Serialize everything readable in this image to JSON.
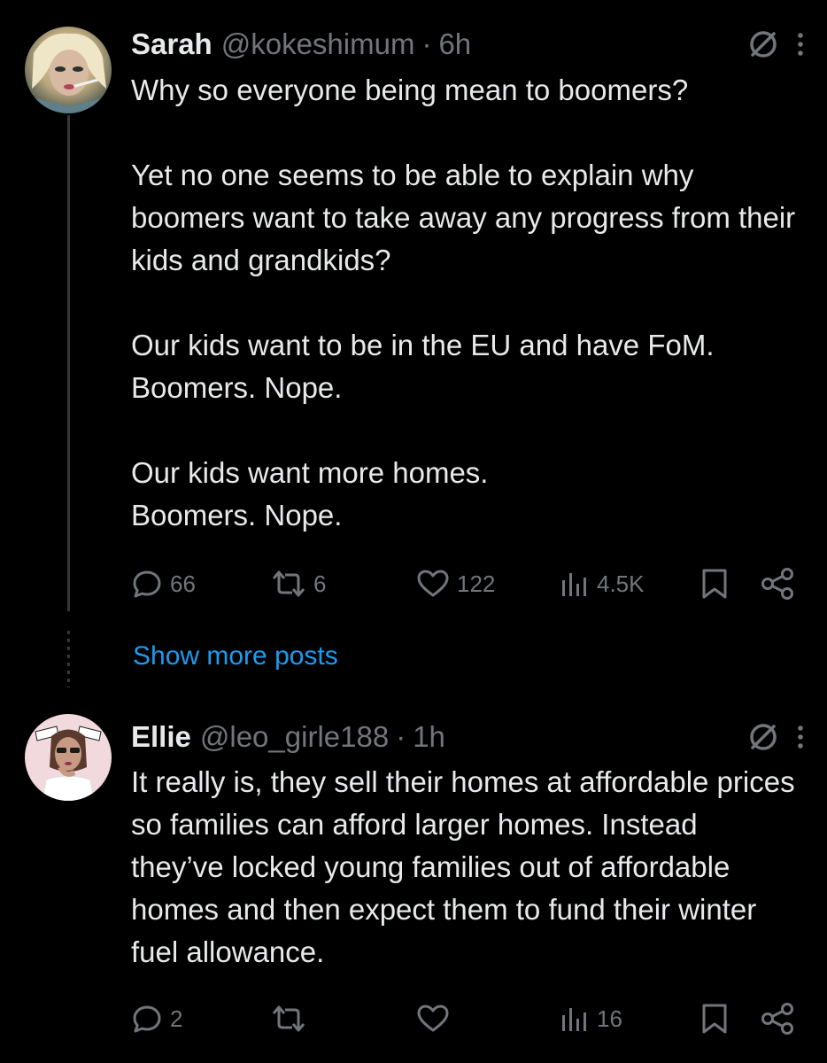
{
  "posts": [
    {
      "name": "Sarah",
      "handle": "@kokeshimum",
      "separator": "·",
      "time": "6h",
      "text": "Why so everyone being mean to boomers?\n\nYet no one seems to be able to explain why boomers want to take away any progress from their kids and grandkids?\n\nOur kids want to be in the EU and have FoM.\nBoomers. Nope.\n\nOur kids want more homes.\nBoomers. Nope.",
      "replies": "66",
      "reposts": "6",
      "likes": "122",
      "views": "4.5K"
    },
    {
      "name": "Ellie",
      "handle": "@leo_girle188",
      "separator": "·",
      "time": "1h",
      "text": "It really is, they sell their homes at affordable prices so families can afford larger homes. Instead they’ve locked young families out of affordable homes and then expect them to fund their winter fuel allowance.",
      "replies": "2",
      "reposts": "",
      "likes": "",
      "views": "16"
    }
  ],
  "show_more_label": "Show more posts",
  "icons": {
    "verified": "no-entry-circle-icon",
    "more": "more-vertical-icon",
    "reply": "reply-bubble-icon",
    "repost": "repost-icon",
    "like": "heart-icon",
    "views": "views-bar-chart-icon",
    "bookmark": "bookmark-icon",
    "share": "share-icon"
  },
  "colors": {
    "background": "#000000",
    "text": "#e7e9ea",
    "muted": "#71767b",
    "link": "#1d9bf0"
  }
}
